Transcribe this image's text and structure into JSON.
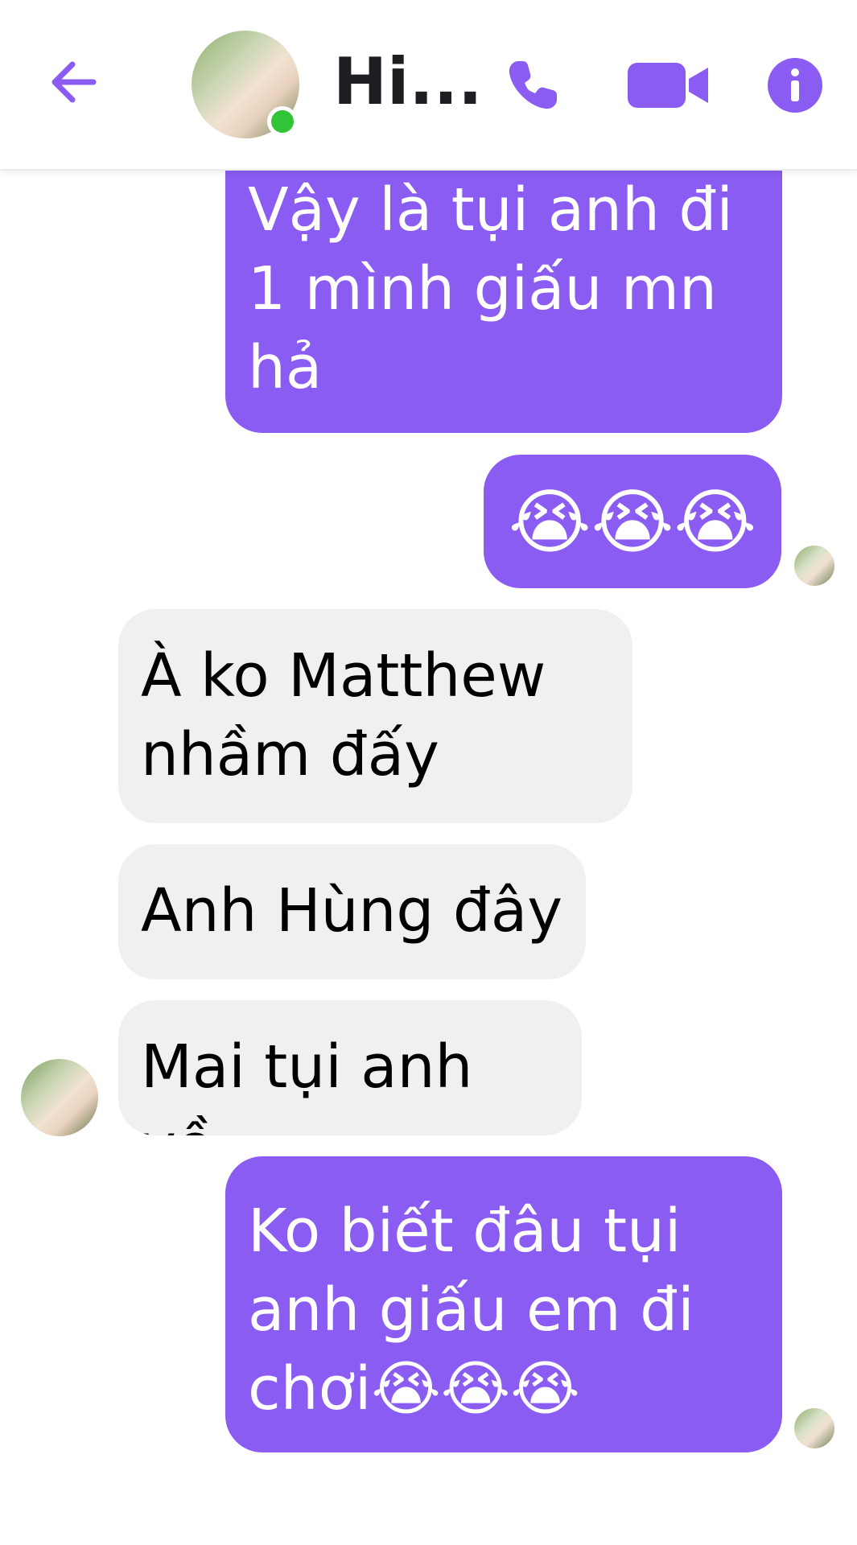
{
  "header": {
    "contact_name": "Hi...",
    "accent_color": "#8b5cf1",
    "icons": [
      "arrow-left-icon",
      "phone-icon",
      "video-camera-icon",
      "info-icon"
    ],
    "online_color": "#31c437"
  },
  "messages": [
    {
      "side": "outgoing",
      "text": "Vậy là tụi anh đi\n1 mình giấu mn\nhả"
    },
    {
      "side": "outgoing",
      "text": "😭😭😭"
    },
    {
      "side": "incoming",
      "text": "À ko Matthew\nnhầm đấy"
    },
    {
      "side": "incoming",
      "text": "Anh Hùng đây"
    },
    {
      "side": "incoming",
      "text": "Mai tụi anh về"
    },
    {
      "side": "outgoing",
      "text": "Ko biết đâu tụi\nanh giấu em đi\nchơi😭😭😭"
    }
  ],
  "colors": {
    "outgoing_bubble": "#8b5cf1",
    "incoming_bubble": "#f0f0f2"
  }
}
